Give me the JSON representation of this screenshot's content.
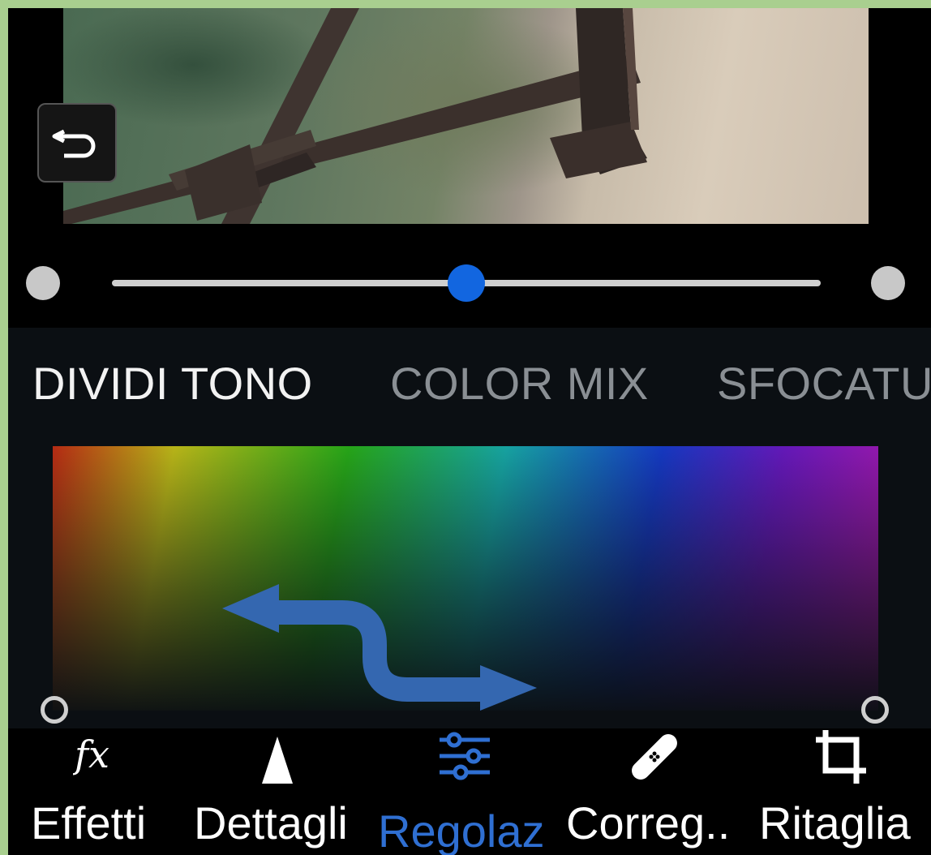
{
  "preview": {
    "undo_icon": "undo-icon"
  },
  "slider": {
    "value_fraction": 0.5
  },
  "tabs": [
    {
      "label": "DIVIDI TONO",
      "active": true
    },
    {
      "label": "COLOR MIX",
      "active": false
    },
    {
      "label": "SFOCATU",
      "active": false
    }
  ],
  "bottom_nav": {
    "effects": {
      "label": "Effetti",
      "icon": "fx-icon"
    },
    "details": {
      "label": "Dettagli",
      "icon": "triangle-icon"
    },
    "adjust": {
      "label": "Regolaz",
      "icon": "sliders-icon",
      "active": true
    },
    "heal": {
      "label": "Correg..",
      "icon": "bandage-icon"
    },
    "crop": {
      "label": "Ritaglia",
      "icon": "crop-icon"
    }
  },
  "colors": {
    "accent": "#1266e0",
    "active_tab": "#f2f2f2",
    "inactive_tab": "#8a8f94",
    "active_nav": "#2f6fd2"
  }
}
